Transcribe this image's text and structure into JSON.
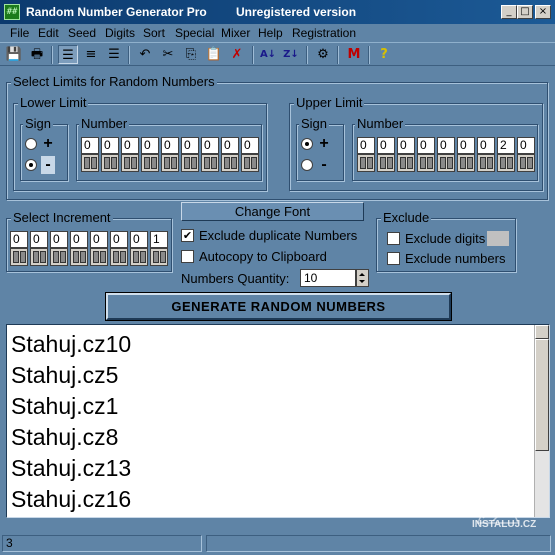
{
  "window": {
    "title": "Random Number Generator Pro",
    "status_text": "Unregistered version",
    "icon_name": "app-grid-icon",
    "controls": [
      "_",
      "□",
      "×"
    ]
  },
  "menu": [
    "File",
    "Edit",
    "Seed",
    "Digits",
    "Sort",
    "Special",
    "Mixer",
    "Help",
    "Registration"
  ],
  "toolbar": [
    {
      "name": "save-icon",
      "glyph": "💾"
    },
    {
      "name": "print-icon",
      "glyph": "🖶"
    },
    {
      "name": "align-left-icon",
      "glyph": "☰"
    },
    {
      "name": "align-center-icon",
      "glyph": "≡"
    },
    {
      "name": "align-right-icon",
      "glyph": "☰"
    },
    {
      "name": "undo-icon",
      "glyph": "↶"
    },
    {
      "name": "cut-icon",
      "glyph": "✂"
    },
    {
      "name": "copy-icon",
      "glyph": "⎘"
    },
    {
      "name": "paste-icon",
      "glyph": "📋"
    },
    {
      "name": "delete-icon",
      "glyph": "✗"
    },
    {
      "name": "sort-ascending-icon",
      "glyph": "A↓"
    },
    {
      "name": "sort-descending-icon",
      "glyph": "Z↓"
    },
    {
      "name": "mixer-icon",
      "glyph": "⚙"
    },
    {
      "name": "m-icon",
      "glyph": "M"
    },
    {
      "name": "help-icon",
      "glyph": "?"
    }
  ],
  "limits": {
    "title": "Select Limits for Random Numbers",
    "lower": {
      "title": "Lower Limit",
      "sign_label": "Sign",
      "number_label": "Number",
      "plus": "+",
      "minus": "-",
      "selected_sign": "-",
      "digits": [
        "0",
        "0",
        "0",
        "0",
        "0",
        "0",
        "0",
        "0",
        "0"
      ]
    },
    "upper": {
      "title": "Upper Limit",
      "sign_label": "Sign",
      "number_label": "Number",
      "plus": "+",
      "minus": "-",
      "selected_sign": "+",
      "digits": [
        "0",
        "0",
        "0",
        "0",
        "0",
        "0",
        "0",
        "2",
        "0"
      ]
    }
  },
  "increment": {
    "title": "Select Increment",
    "digits": [
      "0",
      "0",
      "0",
      "0",
      "0",
      "0",
      "0",
      "1"
    ]
  },
  "options": {
    "change_font": "Change Font",
    "exclude_duplicates": {
      "label": "Exclude duplicate Numbers",
      "checked": true
    },
    "autocopy": {
      "label": "Autocopy to Clipboard",
      "checked": false
    },
    "quantity_label": "Numbers Quantity:",
    "quantity_value": "10"
  },
  "exclude": {
    "title": "Exclude",
    "digits": {
      "label": "Exclude digits",
      "checked": false
    },
    "numbers": {
      "label": "Exclude numbers",
      "checked": false
    }
  },
  "generate_label": "GENERATE RANDOM NUMBERS",
  "results": [
    "Stahuj.cz10",
    "Stahuj.cz5",
    "Stahuj.cz1",
    "Stahuj.cz8",
    "Stahuj.cz13",
    "Stahuj.cz16"
  ],
  "watermark": "INSTALUJ.CZ",
  "statusbar": {
    "count": "3"
  }
}
